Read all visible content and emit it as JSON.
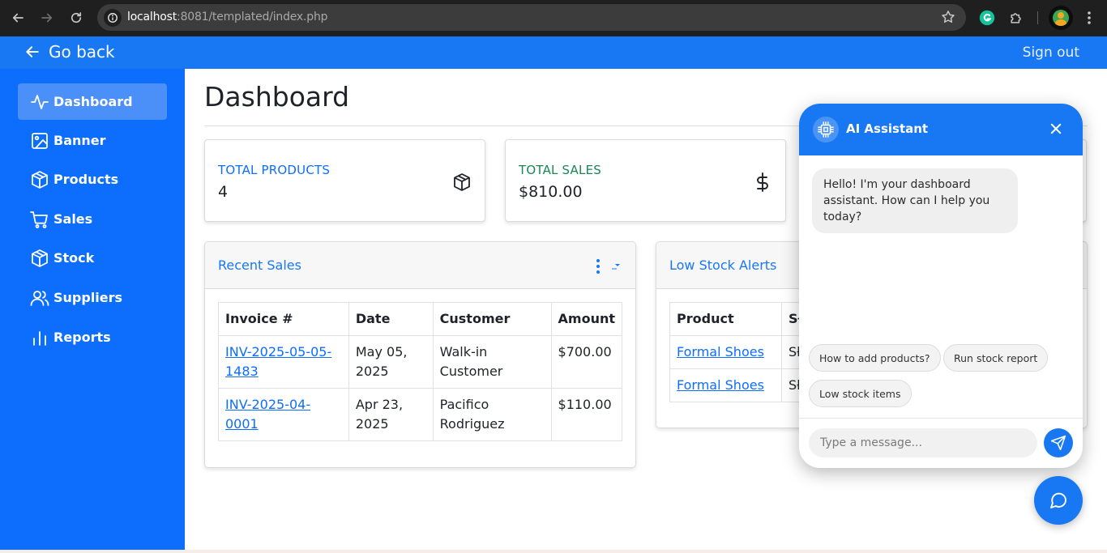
{
  "browser": {
    "url_host": "localhost",
    "url_rest": ":8081/templated/index.php"
  },
  "topbar": {
    "go_back": "Go back",
    "sign_out": "Sign out"
  },
  "sidebar": {
    "items": [
      {
        "label": "Dashboard",
        "icon": "activity-icon"
      },
      {
        "label": "Banner",
        "icon": "image-icon"
      },
      {
        "label": "Products",
        "icon": "box-icon"
      },
      {
        "label": "Sales",
        "icon": "cart-icon"
      },
      {
        "label": "Stock",
        "icon": "box-icon"
      },
      {
        "label": "Suppliers",
        "icon": "people-icon"
      },
      {
        "label": "Reports",
        "icon": "bar-chart-icon"
      }
    ]
  },
  "main": {
    "title": "Dashboard",
    "stats": [
      {
        "label": "TOTAL PRODUCTS",
        "value": "4",
        "color": "#0d6efd"
      },
      {
        "label": "TOTAL SALES",
        "value": "$810.00",
        "color": "#198754"
      }
    ],
    "recent_sales": {
      "title": "Recent Sales",
      "columns": [
        "Invoice #",
        "Date",
        "Customer",
        "Amount"
      ],
      "rows": [
        {
          "invoice_1": "INV-2025-05-05-",
          "invoice_2": "1483",
          "date_1": "May 05,",
          "date_2": "2025",
          "customer_1": "Walk-in",
          "customer_2": "Customer",
          "amount": "$700.00"
        },
        {
          "invoice_1": "INV-2025-04-",
          "invoice_2": "0001",
          "date_1": "Apr 23,",
          "date_2": "2025",
          "customer_1": "Pacifico",
          "customer_2": "Rodriguez",
          "amount": "$110.00"
        }
      ]
    },
    "low_stock": {
      "title": "Low Stock Alerts",
      "columns": [
        "Product",
        "Sł"
      ],
      "rows": [
        {
          "product": "Formal Shoes",
          "col2": "Sł"
        },
        {
          "product": "Formal Shoes",
          "col2": "Sł"
        }
      ]
    }
  },
  "chat": {
    "title": "AI Assistant",
    "greeting": "Hello! I'm your dashboard assistant. How can I help you today?",
    "suggestions": [
      "How to add products?",
      "Run stock report",
      "Low stock items"
    ],
    "input_placeholder": "Type a message..."
  },
  "colors": {
    "primary": "#1877f2",
    "sidebar": "#0d6efd",
    "sidebar_active": "#4b8ff8",
    "success": "#198754"
  }
}
